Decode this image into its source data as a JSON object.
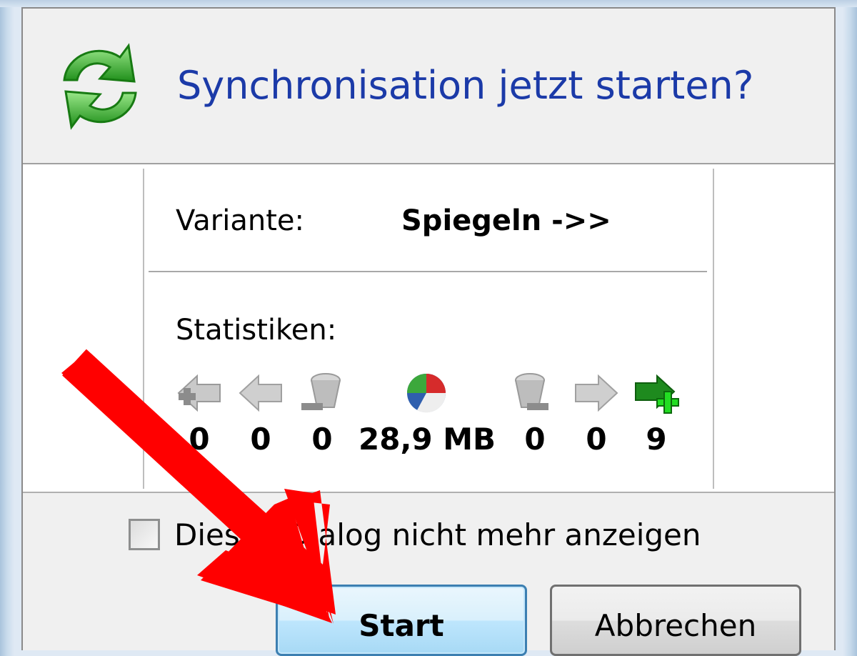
{
  "dialog": {
    "title": "Synchronisation jetzt starten?",
    "variant_label": "Variante:",
    "variant_value": "Spiegeln ->>",
    "stats_label": "Statistiken:",
    "stats": [
      {
        "icon": "create-left-icon",
        "value": "0"
      },
      {
        "icon": "update-left-icon",
        "value": "0"
      },
      {
        "icon": "delete-left-icon",
        "value": "0"
      },
      {
        "icon": "data-pie-icon",
        "value": "28,9 MB"
      },
      {
        "icon": "delete-right-icon",
        "value": "0"
      },
      {
        "icon": "update-right-icon",
        "value": "0"
      },
      {
        "icon": "create-right-icon",
        "value": "9"
      }
    ],
    "checkbox_label": "Diesen Dialog nicht mehr anzeigen",
    "checkbox_checked": false,
    "start_button": "Start",
    "cancel_button": "Abbrechen"
  },
  "colors": {
    "title": "#1b3aa8",
    "annotation_arrow": "#ff0000",
    "sync_icon": "#3fae2a"
  }
}
